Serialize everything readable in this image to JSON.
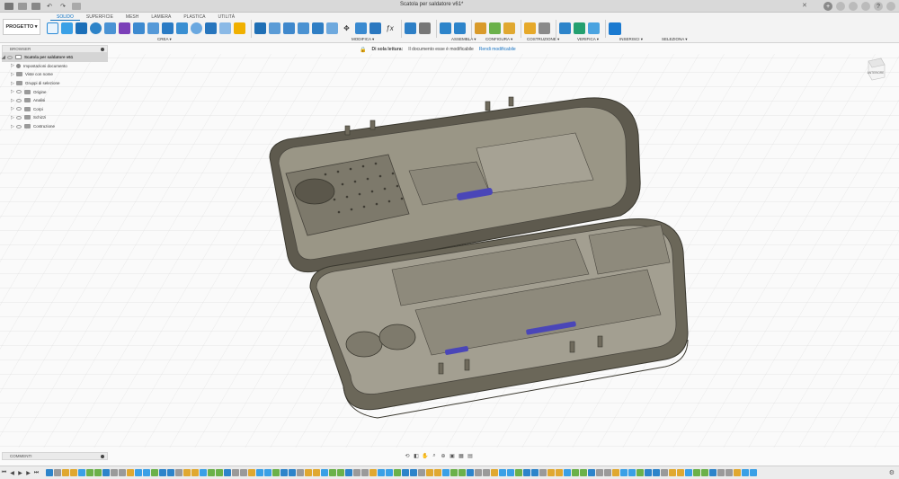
{
  "window": {
    "title": "Scatola per saldatore v61*",
    "close_glyph": "✕"
  },
  "ribbon": {
    "workspace_label": "PROGETTO ▾",
    "tabs": [
      "SOLIDO",
      "SUPERFICIE",
      "MESH",
      "LAMIERA",
      "PLASTICA",
      "UTILITÀ"
    ],
    "active_tab": "SOLIDO",
    "groups": {
      "create": "CREA ▾",
      "modify": "MODIFICA ▾",
      "assemble": "ASSEMBLA ▾",
      "configure": "CONFIGURA ▾",
      "construction": "COSTRUZIONE ▾",
      "inspect": "VERIFICA ▾",
      "insert": "INSERISCI ▾",
      "select": "SELEZIONA ▾"
    },
    "accent_color": "#0a6fc2"
  },
  "banner": {
    "mode": "Di sola lettura:",
    "message": "Il documento esse è modificabile",
    "action": "Rendi modificabile"
  },
  "browser": {
    "header": "BROWSER",
    "root": "Scatola per saldatore v61",
    "items": [
      {
        "label": "Impostazioni documento",
        "icon": "gear-icon"
      },
      {
        "label": "Viste con nome",
        "icon": "folder-icon"
      },
      {
        "label": "Gruppi di selezione",
        "icon": "folder-icon"
      },
      {
        "label": "Origine",
        "icon": "folder-icon"
      },
      {
        "label": "Analisi",
        "icon": "folder-icon"
      },
      {
        "label": "Corpi",
        "icon": "folder-icon"
      },
      {
        "label": "Schizzi",
        "icon": "folder-icon"
      },
      {
        "label": "Costruzione",
        "icon": "folder-icon"
      }
    ]
  },
  "comments": {
    "label": "COMMENTI"
  },
  "viewcube": {
    "face_label": "ANTERIORE"
  },
  "model": {
    "body_color": "#6f6a5c",
    "interior_color": "#a39f91",
    "clip_color": "#4a46b8"
  }
}
